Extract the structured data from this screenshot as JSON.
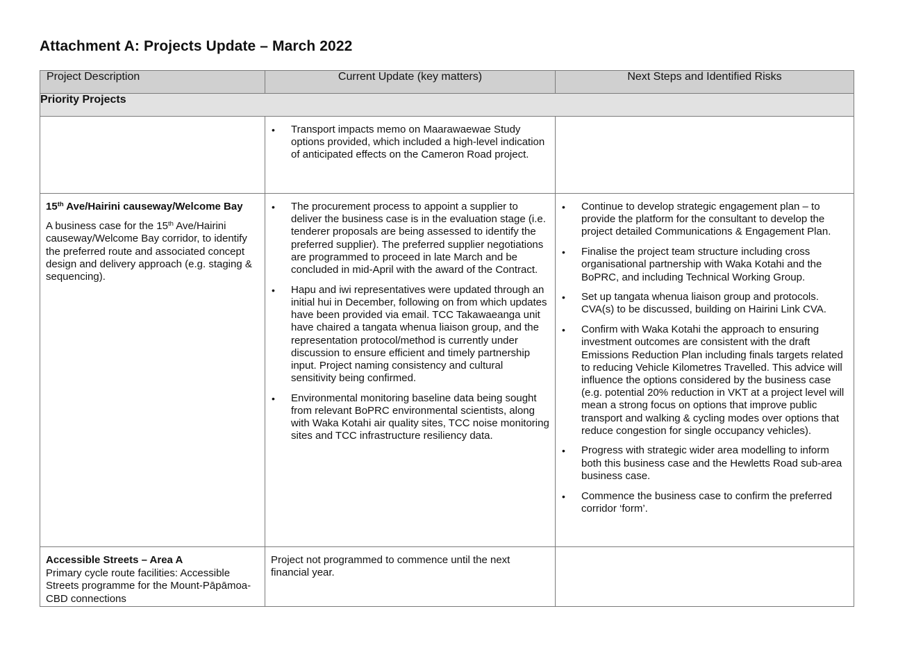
{
  "page": {
    "title": "Attachment A: Projects Update – March 2022"
  },
  "table": {
    "headers": [
      "Project Description",
      "Current Update (key matters)",
      "Next Steps and Identified Risks"
    ],
    "section_label": "Priority Projects",
    "rows": [
      {
        "description": {
          "title_pre": "",
          "title_sup": "",
          "title_post": "",
          "body_pre": "",
          "body_sup": "",
          "body_post": ""
        },
        "current_update": [
          "Transport impacts memo on Maarawaewae Study options provided, which included a high-level indication of anticipated effects on the Cameron Road project."
        ],
        "next_steps": []
      },
      {
        "description": {
          "title_pre": "15",
          "title_sup": "th",
          "title_post": " Ave/Hairini causeway/Welcome Bay",
          "body_pre": "A business case for the 15",
          "body_sup": "th",
          "body_post": " Ave/Hairini causeway/Welcome Bay corridor, to identify the preferred route and associated concept design and delivery approach (e.g. staging & sequencing)."
        },
        "current_update": [
          "The procurement process to appoint a supplier to deliver the business case is in the evaluation stage (i.e. tenderer proposals are being assessed to identify the preferred supplier). The preferred supplier negotiations are programmed to proceed in late March and be concluded in mid-April with the award of the Contract.",
          "Hapu and iwi representatives were updated through an initial hui in December, following on from which updates have been provided via email. TCC Takawaeanga unit have chaired a tangata whenua liaison group, and the representation protocol/method is currently under discussion to ensure efficient and timely partnership input. Project naming consistency and cultural sensitivity being confirmed.",
          "Environmental monitoring baseline data being sought from relevant BoPRC environmental scientists, along with Waka Kotahi air quality sites, TCC noise monitoring sites and TCC infrastructure resiliency data."
        ],
        "next_steps": [
          "Continue to develop strategic engagement plan – to provide the platform for the consultant to develop the project detailed Communications & Engagement Plan.",
          "Finalise the project team structure including cross organisational partnership with Waka Kotahi and the BoPRC, and including Technical Working Group.",
          "Set up tangata whenua liaison group and protocols. CVA(s) to be discussed, building on Hairini Link CVA.",
          "Confirm with Waka Kotahi the approach to ensuring investment outcomes are consistent with the draft Emissions Reduction Plan including finals targets related to reducing Vehicle Kilometres Travelled. This advice will influence the options considered by the business case (e.g. potential 20% reduction in VKT at a project level will mean a strong focus on options that improve public transport and walking & cycling modes over options that reduce congestion for single occupancy vehicles).",
          "Progress with strategic wider area modelling to inform both this business case and the Hewletts Road sub-area business case.",
          "Commence the business case to confirm the preferred corridor ‘form’."
        ]
      },
      {
        "description": {
          "title": "Accessible Streets – Area A",
          "body": "Primary cycle route facilities: Accessible Streets programme for the Mount-Pāpāmoa-CBD connections"
        },
        "current_update_text": "Project not programmed to commence until the next financial year.",
        "next_steps": []
      }
    ]
  }
}
